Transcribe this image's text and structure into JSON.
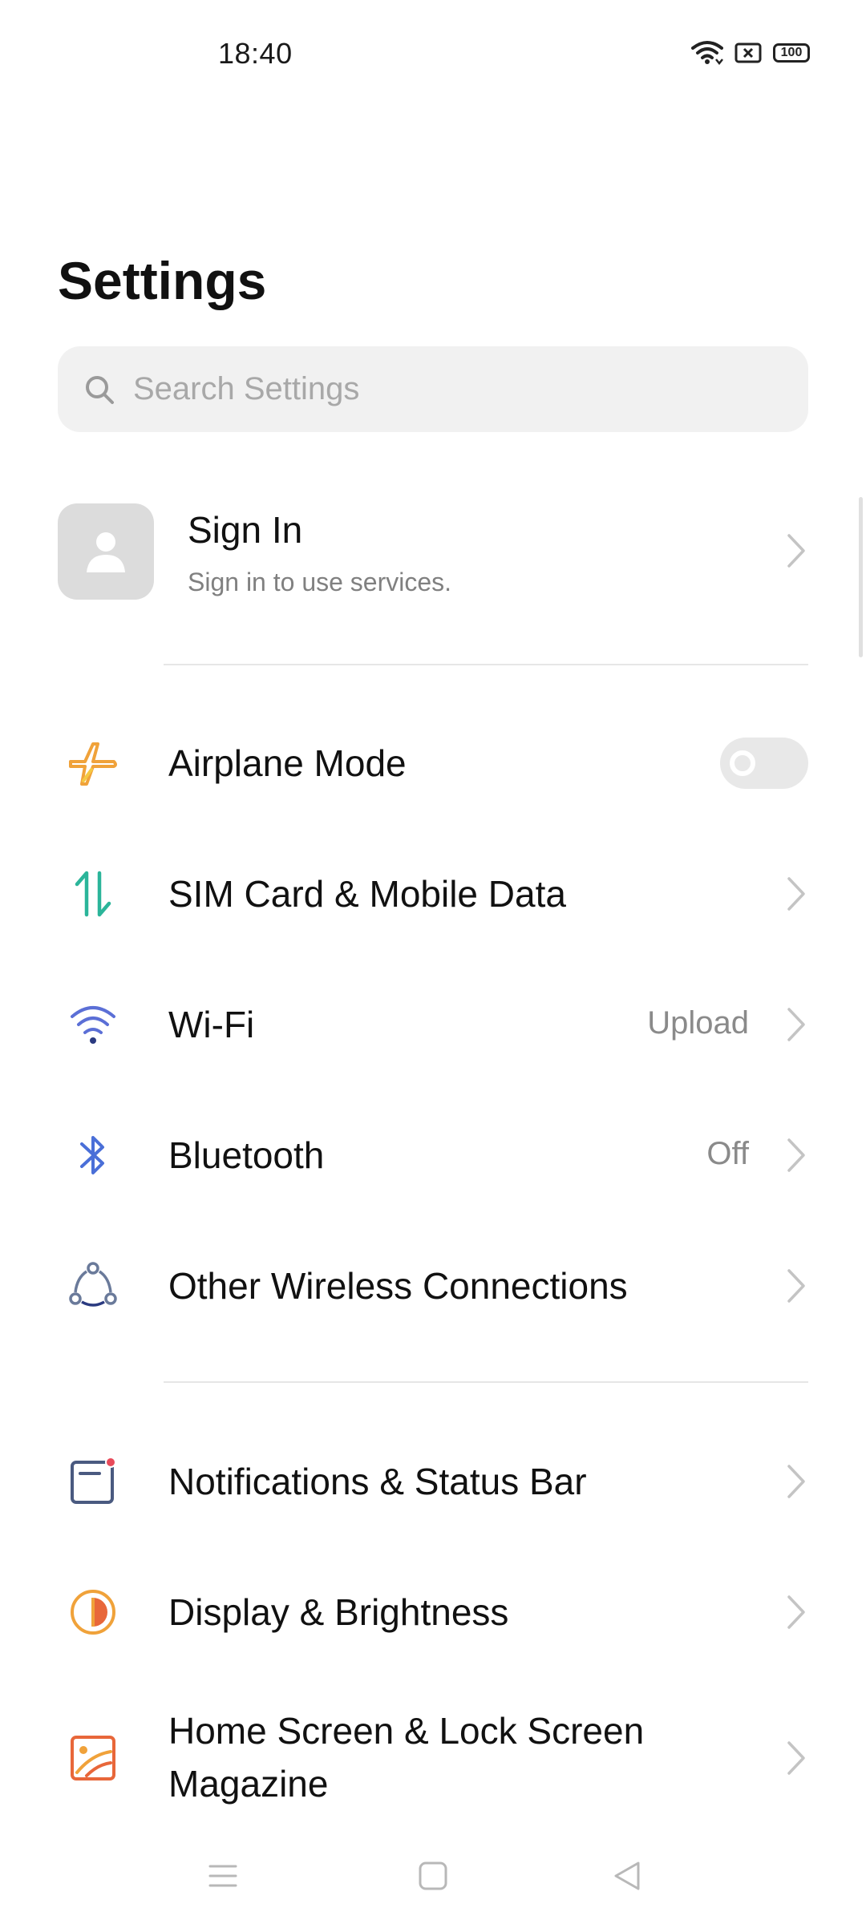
{
  "status_bar": {
    "time": "18:40",
    "battery": "100",
    "icons": [
      "wifi-icon",
      "sim-error-icon",
      "battery-icon"
    ]
  },
  "page": {
    "title": "Settings"
  },
  "search": {
    "placeholder": "Search Settings"
  },
  "account": {
    "title": "Sign In",
    "subtitle": "Sign in to use services."
  },
  "sections": [
    [
      {
        "label": "Airplane Mode",
        "icon": "airplane-icon",
        "control": "toggle",
        "on": false,
        "color": "#f0a23a"
      },
      {
        "label": "SIM Card & Mobile Data",
        "icon": "mobile-data-icon",
        "control": "chevron",
        "color": "#2bb59a"
      },
      {
        "label": "Wi-Fi",
        "value": "Upload",
        "icon": "wifi-icon",
        "control": "chevron",
        "color": "#5b6fd6"
      },
      {
        "label": "Bluetooth",
        "value": "Off",
        "icon": "bluetooth-icon",
        "control": "chevron",
        "color": "#4a6fd8"
      },
      {
        "label": "Other Wireless Connections",
        "icon": "connections-icon",
        "control": "chevron",
        "color": "#6a7a9a"
      }
    ],
    [
      {
        "label": "Notifications & Status Bar",
        "icon": "notifications-icon",
        "control": "chevron",
        "color": "#4a5a80"
      },
      {
        "label": "Display & Brightness",
        "icon": "brightness-icon",
        "control": "chevron",
        "color": "#f0a23a"
      },
      {
        "label": "Home Screen & Lock Screen Magazine",
        "label_line1": "Home Screen & Lock Screen",
        "label_line2": "Magazine",
        "icon": "wallpaper-icon",
        "control": "chevron",
        "color": "#e8673a"
      }
    ]
  ],
  "nav_bar": {
    "icons": [
      "menu-icon",
      "home-icon",
      "back-icon"
    ]
  }
}
